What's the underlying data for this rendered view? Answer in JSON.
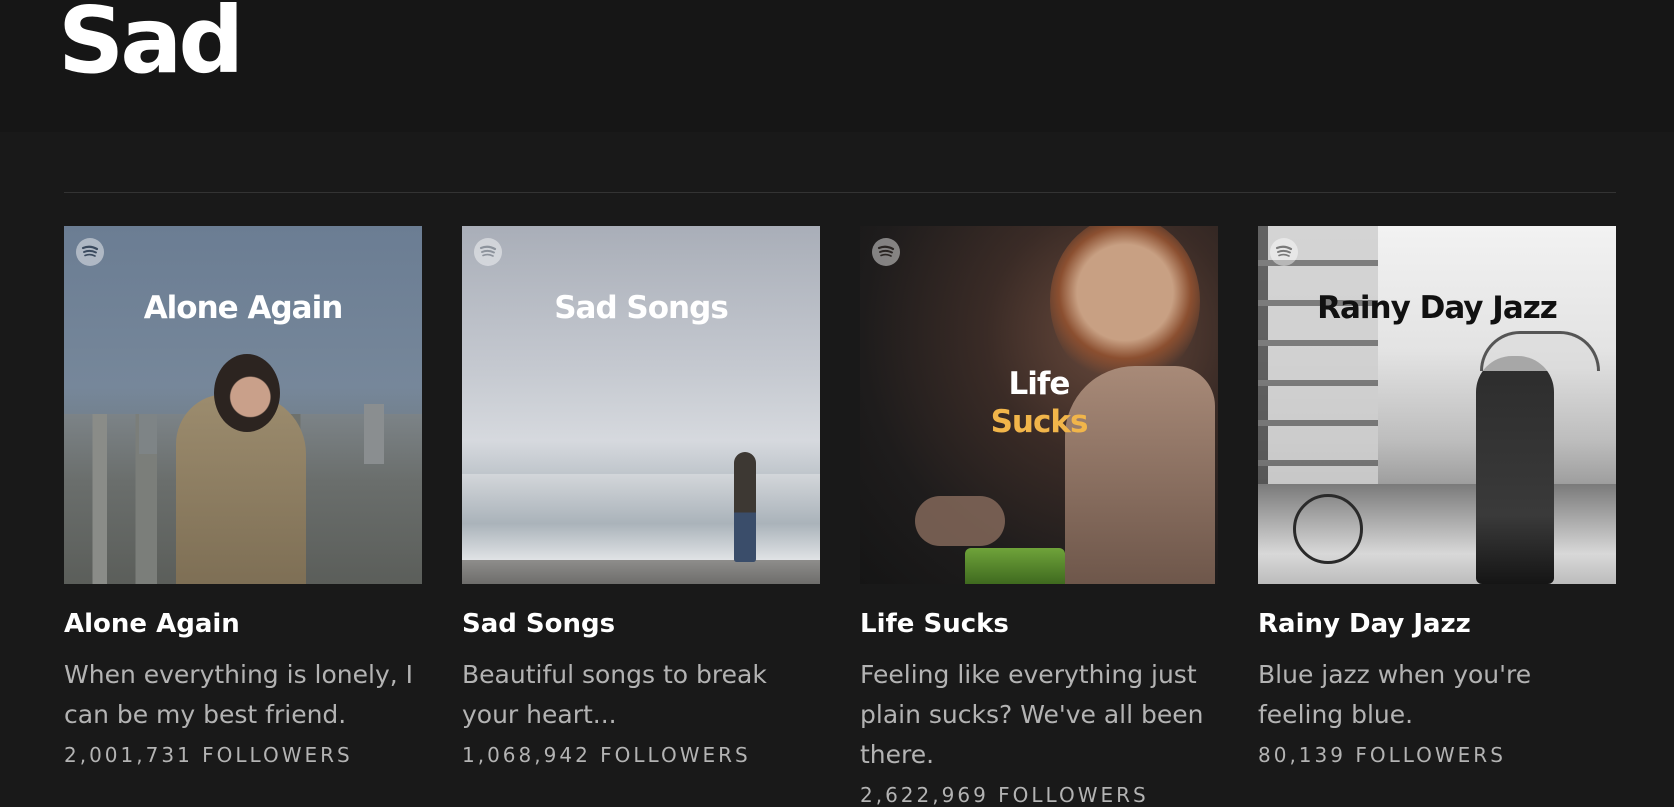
{
  "page": {
    "title": "Sad"
  },
  "playlists": [
    {
      "cover_title": "Alone Again",
      "title": "Alone Again",
      "description": "When everything is lonely, I can be my best friend.",
      "followers": "2,001,731 FOLLOWERS"
    },
    {
      "cover_title": "Sad Songs",
      "title": "Sad Songs",
      "description": "Beautiful songs to break your heart...",
      "followers": "1,068,942 FOLLOWERS"
    },
    {
      "cover_title_line1": "Life",
      "cover_title_line2": "Sucks",
      "title": "Life Sucks",
      "description": "Feeling like everything just plain sucks? We've all been there.",
      "followers": "2,622,969 FOLLOWERS"
    },
    {
      "cover_title": "Rainy Day Jazz",
      "title": "Rainy Day Jazz",
      "description": "Blue jazz when you're feeling blue.",
      "followers": "80,139 FOLLOWERS"
    }
  ],
  "icons": {
    "badge": "spotify-logo-icon"
  },
  "colors": {
    "background": "#191919",
    "header_background": "#161616",
    "title_text": "#ffffff",
    "secondary_text": "#b3b3b3",
    "accent_life_sucks": "#f1b54a"
  }
}
